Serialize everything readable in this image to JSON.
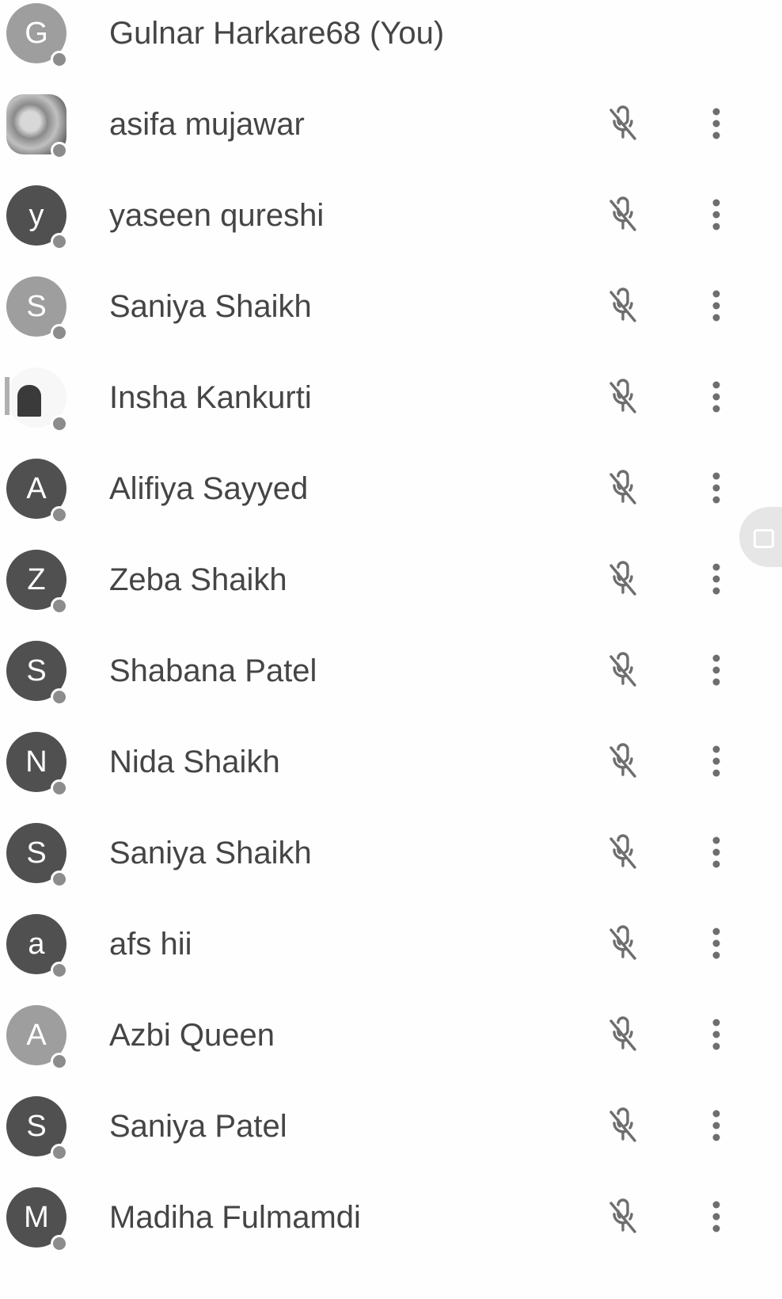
{
  "participants": [
    {
      "initial": "G",
      "name": "Gulnar Harkare68 (You)",
      "avatar_style": "light",
      "muted": false
    },
    {
      "initial": "",
      "name": "asifa mujawar",
      "avatar_style": "photo-a",
      "muted": true
    },
    {
      "initial": "y",
      "name": "yaseen qureshi",
      "avatar_style": "dark",
      "muted": true
    },
    {
      "initial": "S",
      "name": "Saniya Shaikh",
      "avatar_style": "light",
      "muted": true
    },
    {
      "initial": "",
      "name": "Insha Kankurti",
      "avatar_style": "photo-b",
      "muted": true
    },
    {
      "initial": "A",
      "name": "Alifiya Sayyed",
      "avatar_style": "dark",
      "muted": true
    },
    {
      "initial": "Z",
      "name": "Zeba Shaikh",
      "avatar_style": "dark",
      "muted": true
    },
    {
      "initial": "S",
      "name": "Shabana Patel",
      "avatar_style": "dark",
      "muted": true
    },
    {
      "initial": "N",
      "name": "Nida Shaikh",
      "avatar_style": "dark",
      "muted": true
    },
    {
      "initial": "S",
      "name": "Saniya Shaikh",
      "avatar_style": "dark",
      "muted": true
    },
    {
      "initial": "a",
      "name": "afs hii",
      "avatar_style": "dark",
      "muted": true
    },
    {
      "initial": "A",
      "name": "Azbi Queen",
      "avatar_style": "light",
      "muted": true
    },
    {
      "initial": "S",
      "name": "Saniya Patel",
      "avatar_style": "dark",
      "muted": true
    },
    {
      "initial": "M",
      "name": "Madiha Fulmamdi",
      "avatar_style": "dark",
      "muted": true
    }
  ],
  "icons": {
    "mic": "mic-off-icon",
    "more": "more-vert-icon",
    "presence": "presence-dot"
  },
  "colors": {
    "text": "#454545",
    "avatar_dark": "#505050",
    "avatar_light": "#9e9e9e",
    "icon": "#6e6e6e"
  }
}
